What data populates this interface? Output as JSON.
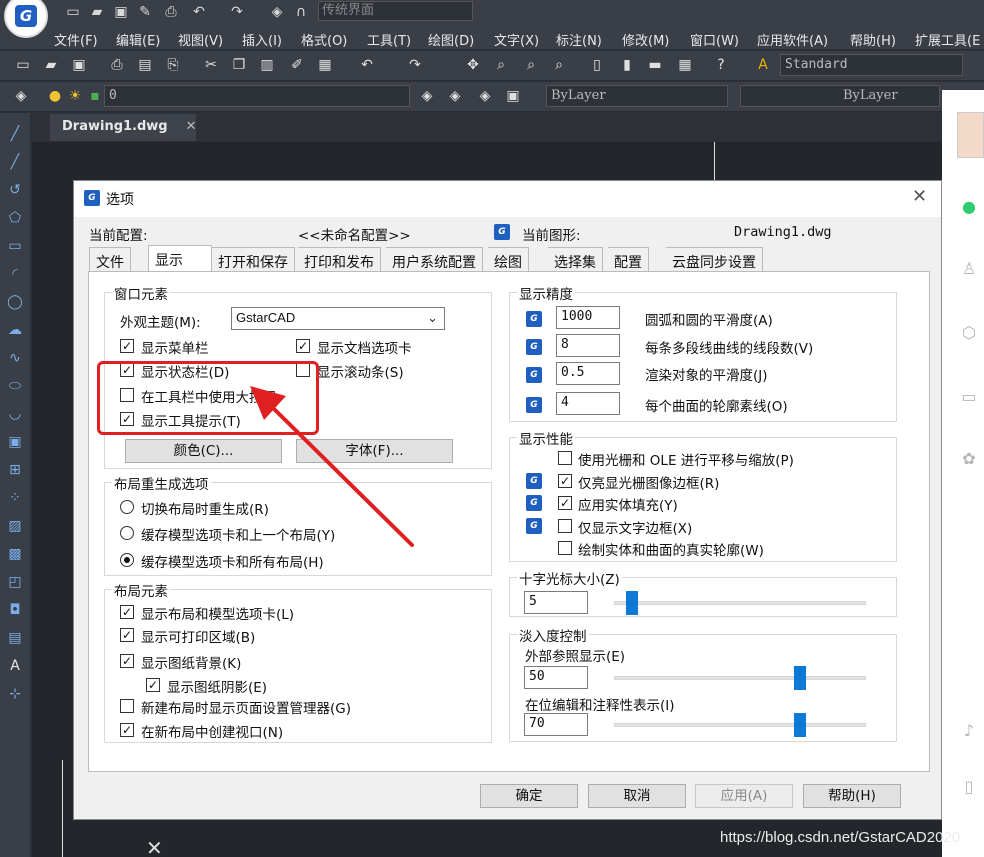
{
  "app": {
    "workspace": "传统界面",
    "menu": [
      "文件(F)",
      "编辑(E)",
      "视图(V)",
      "插入(I)",
      "格式(O)",
      "工具(T)",
      "绘图(D)",
      "文字(X)",
      "标注(N)",
      "修改(M)",
      "窗口(W)",
      "应用软件(A)",
      "帮助(H)",
      "扩展工具(E"
    ],
    "text_style": "Standard",
    "layer_value": "0",
    "color_value": "ByLayer",
    "linetype_value": "ByLayer",
    "doc_tab": "Drawing1.dwg",
    "watermark": "https://blog.csdn.net/GstarCAD2020"
  },
  "dialog": {
    "title": "选项",
    "current_config_label": "当前配置:",
    "current_config_value": "<<未命名配置>>",
    "current_drawing_label": "当前图形:",
    "current_drawing_value": "Drawing1.dwg",
    "tabs": [
      "文件",
      "显示",
      "打开和保存",
      "打印和发布",
      "用户系统配置",
      "绘图",
      "选择集",
      "配置",
      "云盘同步设置"
    ],
    "window_elements": {
      "legend": "窗口元素",
      "theme_label": "外观主题(M):",
      "theme_value": "GstarCAD",
      "show_menubar": "显示菜单栏",
      "show_doc_tabs": "显示文档选项卡",
      "show_statusbar": "显示状态栏(D)",
      "show_scrollbars": "显示滚动条(S)",
      "large_buttons": "在工具栏中使用大按钮",
      "show_tooltips": "显示工具提示(T)",
      "colors_button": "颜色(C)...",
      "fonts_button": "字体(F)..."
    },
    "layout_regen": {
      "legend": "布局重生成选项",
      "opt1": "切换布局时重生成(R)",
      "opt2": "缓存模型选项卡和上一个布局(Y)",
      "opt3": "缓存模型选项卡和所有布局(H)"
    },
    "layout_elements": {
      "legend": "布局元素",
      "item1": "显示布局和模型选项卡(L)",
      "item2": "显示可打印区域(B)",
      "item3": "显示图纸背景(K)",
      "item4": "显示图纸阴影(E)",
      "item5": "新建布局时显示页面设置管理器(G)",
      "item6": "在新布局中创建视口(N)"
    },
    "precision": {
      "legend": "显示精度",
      "arc_value": "1000",
      "arc_label": "圆弧和圆的平滑度(A)",
      "pline_value": "8",
      "pline_label": "每条多段线曲线的线段数(V)",
      "render_value": "0.5",
      "render_label": "渲染对象的平滑度(J)",
      "contour_value": "4",
      "contour_label": "每个曲面的轮廓素线(O)"
    },
    "performance": {
      "legend": "显示性能",
      "item1": "使用光栅和 OLE 进行平移与缩放(P)",
      "item2": "仅亮显光栅图像边框(R)",
      "item3": "应用实体填充(Y)",
      "item4": "仅显示文字边框(X)",
      "item5": "绘制实体和曲面的真实轮廓(W)"
    },
    "crosshair": {
      "legend": "十字光标大小(Z)",
      "value": "5",
      "level_fraction": 0.05
    },
    "fade": {
      "legend": "淡入度控制",
      "xref_label": "外部参照显示(E)",
      "xref_value": "50",
      "xref_fraction": 0.75,
      "inplace_label": "在位编辑和注释性表示(I)",
      "inplace_value": "70",
      "inplace_fraction": 0.75
    },
    "buttons": {
      "ok": "确定",
      "cancel": "取消",
      "apply": "应用(A)",
      "help": "帮助(H)"
    }
  },
  "colors": {
    "accent": "#0a7ad6",
    "annotation": "#e02020",
    "brand": "#1e5fbf"
  }
}
